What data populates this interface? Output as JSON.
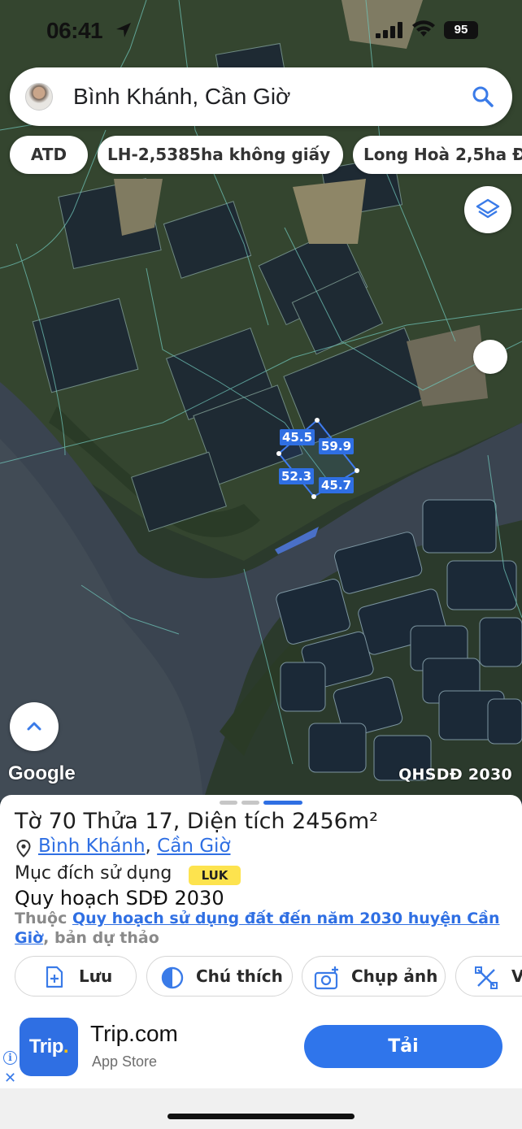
{
  "status_bar": {
    "time": "06:41",
    "battery": "95"
  },
  "search": {
    "query": "Bình Khánh, Cần Giờ"
  },
  "chips": [
    "ATD",
    "LH-2,5385ha không giấy",
    "Long Hoà 2,5ha Đ"
  ],
  "map": {
    "attribution": "Google",
    "overlay_tag": "QHSDĐ 2030",
    "parcel_edges": [
      "45.5",
      "59.9",
      "52.3",
      "45.7"
    ],
    "parcel_color": "#2f6fe3"
  },
  "sheet": {
    "title": "Tờ 70 Thửa 17, Diện tích 2456m²",
    "commune": "Bình Khánh",
    "separator": ", ",
    "district": "Cần Giờ",
    "purpose_label": "Mục đích sử dụng",
    "purpose_code": "LUK",
    "plan_heading": "Quy hoạch SDĐ 2030",
    "plan_prefix": "Thuộc ",
    "plan_link": "Quy hoạch sử dụng đất đến năm 2030 huyện Cần Giờ",
    "plan_suffix": ", bản dự thảo",
    "actions": [
      "Lưu",
      "Chú thích",
      "Chụp ảnh",
      "Vẽ"
    ]
  },
  "ad": {
    "logo_main": "Trip",
    "logo_dot": ".",
    "title": "Trip.com",
    "subtitle": "App Store",
    "button": "Tải",
    "info": "i",
    "close": "✕"
  },
  "colors": {
    "accent": "#2f6fe3",
    "badge": "#fde34e"
  }
}
